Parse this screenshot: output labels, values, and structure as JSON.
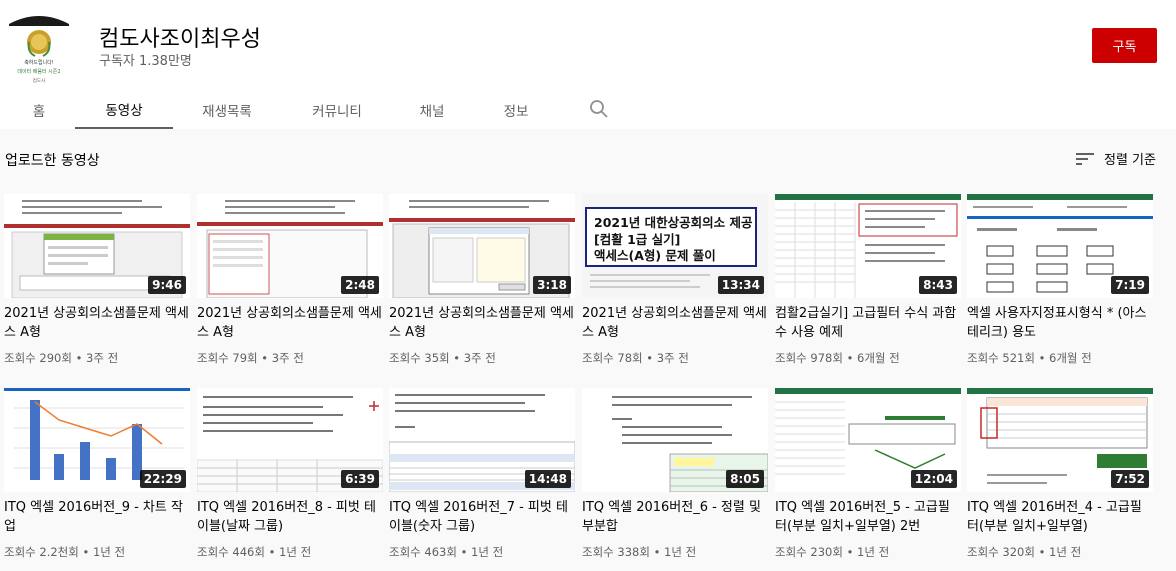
{
  "channel": {
    "name": "컴도사조이최우성",
    "subscribers": "구독자 1.38만명",
    "subscribe_label": "구독",
    "avatar_text_1": "축하드립니다!",
    "avatar_text_2": "데이터 배움터 시즌2",
    "avatar_text_3": "컴도사"
  },
  "tabs": [
    {
      "label": "홈",
      "active": false
    },
    {
      "label": "동영상",
      "active": true
    },
    {
      "label": "재생목록",
      "active": false
    },
    {
      "label": "커뮤니티",
      "active": false
    },
    {
      "label": "채널",
      "active": false
    },
    {
      "label": "정보",
      "active": false
    }
  ],
  "section": {
    "title": "업로드한 동영상",
    "sort_label": "정렬 기준"
  },
  "videos": [
    {
      "title": "2021년 상공회의소샘플문제 액세스 A형",
      "meta": "조회수 290회 • 3주 전",
      "duration": "9:46"
    },
    {
      "title": "2021년 상공회의소샘플문제 액세스 A형",
      "meta": "조회수 79회 • 3주 전",
      "duration": "2:48"
    },
    {
      "title": "2021년 상공회의소샘플문제 액세스 A형",
      "meta": "조회수 35회 • 3주 전",
      "duration": "3:18"
    },
    {
      "title": "2021년 상공회의소샘플문제 액세스 A형",
      "meta": "조회수 78회 • 3주 전",
      "duration": "13:34"
    },
    {
      "title": "컴활2급실기] 고급필터 수식 과함수 사용 예제",
      "meta": "조회수 978회 • 6개월 전",
      "duration": "8:43"
    },
    {
      "title": "엑셀 사용자지정표시형식 * (아스테리크) 용도",
      "meta": "조회수 521회 • 6개월 전",
      "duration": "7:19"
    },
    {
      "title": "ITQ 엑셀 2016버전_9 - 차트 작업",
      "meta": "조회수 2.2천회 • 1년 전",
      "duration": "22:29"
    },
    {
      "title": "ITQ 엑셀 2016버전_8 - 피벗 테이블(날짜 그룹)",
      "meta": "조회수 446회 • 1년 전",
      "duration": "6:39"
    },
    {
      "title": "ITQ 엑셀 2016버전_7 - 피벗 테이블(숫자 그룹)",
      "meta": "조회수 463회 • 1년 전",
      "duration": "14:48"
    },
    {
      "title": "ITQ 엑셀 2016버전_6 - 정렬 및 부분합",
      "meta": "조회수 338회 • 1년 전",
      "duration": "8:05"
    },
    {
      "title": "ITQ 엑셀 2016버전_5 - 고급필터(부분 일치+일부열) 2번",
      "meta": "조회수 230회 • 1년 전",
      "duration": "12:04"
    },
    {
      "title": "ITQ 엑셀 2016버전_4 - 고급필터(부분 일치+일부열)",
      "meta": "조회수 320회 • 1년 전",
      "duration": "7:52"
    }
  ],
  "thumb_texts": {
    "t4_line1": "2021년 대한상공회의소 제공",
    "t4_line2": "[컴활 1급 실기]",
    "t4_line3": "액세스(A형) 문제 풀이"
  },
  "colors": {
    "subscribe": "#cc0000",
    "header_bg": "#ffffff",
    "page_bg": "#f9f9f9"
  }
}
